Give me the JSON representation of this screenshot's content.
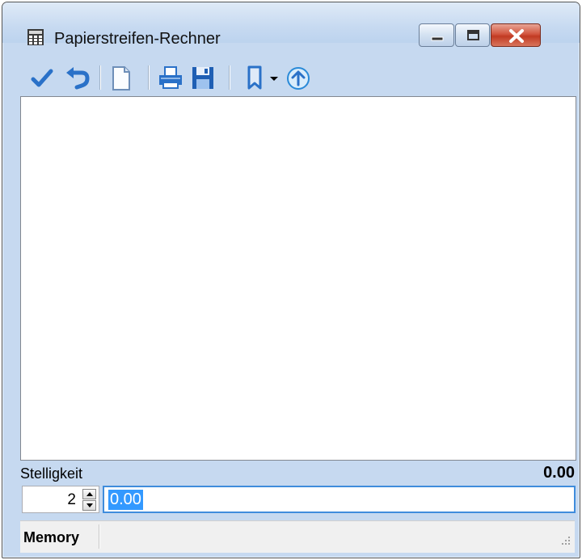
{
  "window": {
    "title": "Papierstreifen-Rechner",
    "controls": [
      "minimize",
      "maximize",
      "close"
    ]
  },
  "toolbar": {
    "items": [
      {
        "name": "check",
        "icon": "checkmark-icon"
      },
      {
        "name": "undo",
        "icon": "undo-icon"
      },
      {
        "name": "new",
        "icon": "new-document-icon"
      },
      {
        "name": "print",
        "icon": "printer-icon"
      },
      {
        "name": "save",
        "icon": "floppy-disk-icon"
      },
      {
        "name": "bookmark",
        "icon": "bookmark-icon",
        "has_dropdown": true
      },
      {
        "name": "upload",
        "icon": "arrow-up-circle-icon"
      }
    ]
  },
  "tape": {
    "lines": []
  },
  "stelligkeit": {
    "label": "Stelligkeit",
    "value": "2",
    "total": "0.00"
  },
  "input": {
    "value": "0.00"
  },
  "statusbar": {
    "memory_label": "Memory"
  },
  "colors": {
    "title_bar": "#c6d9f0",
    "close_button": "#c9442c",
    "accent_blue": "#2a71c8",
    "selection": "#3399ff"
  }
}
